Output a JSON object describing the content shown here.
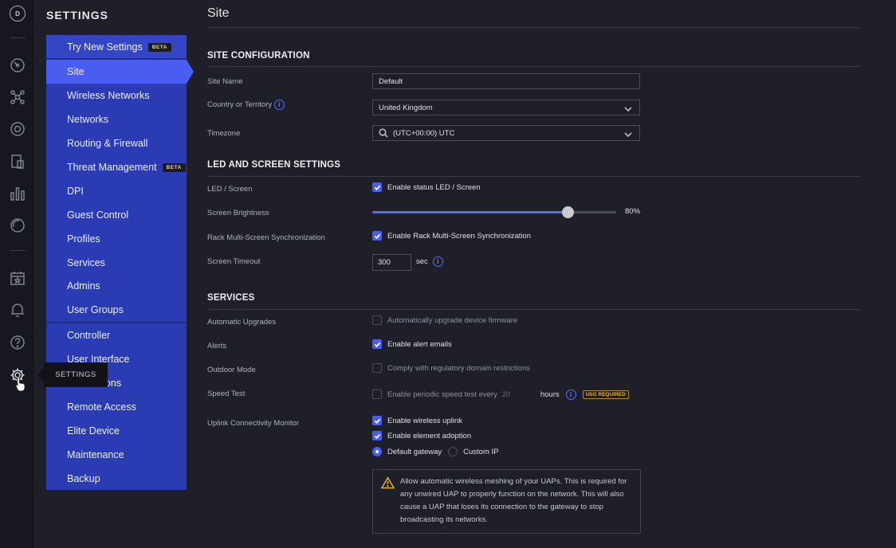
{
  "rail": {
    "logo_letter": "D",
    "icons": [
      "dashboard-icon",
      "topology-icon",
      "devices-icon",
      "clients-icon",
      "statistics-icon",
      "insights-icon",
      "events-icon",
      "alerts-icon",
      "help-icon",
      "settings-icon"
    ]
  },
  "settings_title": "SETTINGS",
  "tooltip": "SETTINGS",
  "nav": {
    "try_new": "Try New Settings",
    "beta": "BETA",
    "items": [
      "Site",
      "Wireless Networks",
      "Networks",
      "Routing & Firewall",
      "Threat Management",
      "DPI",
      "Guest Control",
      "Profiles",
      "Services",
      "Admins",
      "User Groups"
    ],
    "system_items": [
      "Controller",
      "User Interface",
      "Notifications",
      "Remote Access",
      "Elite Device",
      "Maintenance",
      "Backup"
    ],
    "active": "Site"
  },
  "page": {
    "title": "Site"
  },
  "site_config": {
    "heading": "SITE CONFIGURATION",
    "site_name_label": "Site Name",
    "site_name_value": "Default",
    "country_label": "Country or Territory",
    "country_value": "United Kingdom",
    "timezone_label": "Timezone",
    "timezone_value": "(UTC+00:00) UTC"
  },
  "led": {
    "heading": "LED AND SCREEN SETTINGS",
    "led_label": "LED / Screen",
    "led_option": "Enable status LED / Screen",
    "led_checked": true,
    "brightness_label": "Screen Brightness",
    "brightness_value": "80%",
    "brightness_fraction": 0.8,
    "rack_label": "Rack Multi-Screen Synchronization",
    "rack_option": "Enable Rack Multi-Screen Synchronization",
    "rack_checked": true,
    "timeout_label": "Screen Timeout",
    "timeout_value": "300",
    "timeout_unit": "sec"
  },
  "services": {
    "heading": "SERVICES",
    "auto_upgrades_label": "Automatic Upgrades",
    "auto_upgrades_option": "Automatically upgrade device firmware",
    "alerts_label": "Alerts",
    "alerts_option": "Enable alert emails",
    "outdoor_label": "Outdoor Mode",
    "outdoor_option": "Comply with regulatory domain restrictions",
    "speed_label": "Speed Test",
    "speed_option": "Enable periodic speed test every",
    "speed_hours_value": "20",
    "speed_unit": "hours",
    "usg_badge": "USG REQUIRED",
    "uplink_label": "Uplink Connectivity Monitor",
    "wireless_uplink": "Enable wireless uplink",
    "element_adoption": "Enable element adoption",
    "default_gateway": "Default gateway",
    "custom_ip": "Custom IP",
    "warning_text": "Allow automatic wireless meshing of your UAPs. This is required for any unwired UAP to properly function on the network. This will also cause a UAP that loses its connection to the gateway to stop broadcasting its networks."
  },
  "colors": {
    "accent": "#4a5df1",
    "nav_bg": "#2b3bb3",
    "warning": "#e2b43c"
  }
}
